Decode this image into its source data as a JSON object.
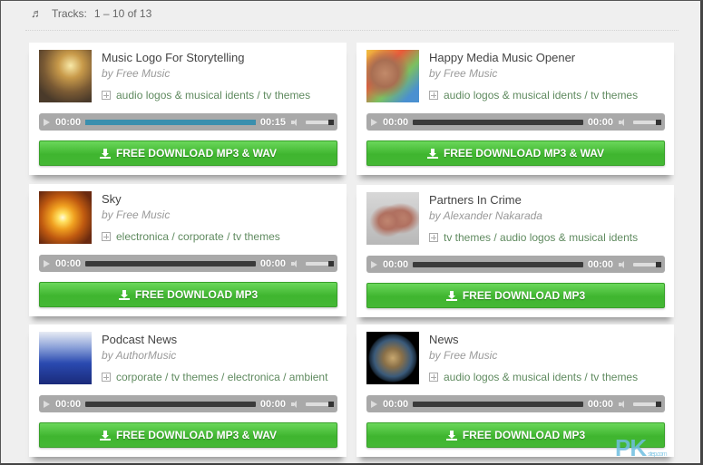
{
  "header": {
    "icon": "music-note-icon",
    "label": "Tracks:",
    "range": "1 – 10 of 13"
  },
  "colors": {
    "download_button": "#45b835",
    "progress_fill": "#3a8fae",
    "tag_text": "#5f8a5f",
    "player_bg": "#a9a9a9"
  },
  "tracks": [
    {
      "title": "Music Logo For Storytelling",
      "author": "by Free Music",
      "tags": "audio logos & musical idents / tv themes",
      "current_time": "00:00",
      "duration": "00:15",
      "progress": 1.0,
      "download_label": "FREE DOWNLOAD  MP3 & WAV",
      "thumb": "library-image"
    },
    {
      "title": "Happy Media Music Opener",
      "author": "by Free Music",
      "tags": "audio logos & musical idents / tv themes",
      "current_time": "00:00",
      "duration": "00:00",
      "progress": 0,
      "download_label": "FREE DOWNLOAD  MP3 & WAV",
      "thumb": "hands-image"
    },
    {
      "title": "Sky",
      "author": "by Free Music",
      "tags": "electronica / corporate / tv themes",
      "current_time": "00:00",
      "duration": "00:00",
      "progress": 0,
      "download_label": "FREE DOWNLOAD  MP3",
      "thumb": "sunset-image"
    },
    {
      "title": "Partners In Crime",
      "author": "by Alexander Nakarada",
      "tags": "tv themes / audio logos & musical idents",
      "current_time": "00:00",
      "duration": "00:00",
      "progress": 0,
      "download_label": "FREE DOWNLOAD  MP3",
      "thumb": "fingers-image"
    },
    {
      "title": "Podcast News",
      "author": "by AuthorMusic",
      "tags": "corporate / tv themes / electronica / ambient",
      "current_time": "00:00",
      "duration": "00:00",
      "progress": 0,
      "download_label": "FREE DOWNLOAD  MP3 & WAV",
      "thumb": "city-image"
    },
    {
      "title": "News",
      "author": "by Free Music",
      "tags": "audio logos & musical idents / tv themes",
      "current_time": "00:00",
      "duration": "00:00",
      "progress": 0,
      "download_label": "FREE DOWNLOAD  MP3",
      "thumb": "globe-image"
    }
  ],
  "watermark": {
    "text": "PK",
    "sub": "step.com"
  }
}
